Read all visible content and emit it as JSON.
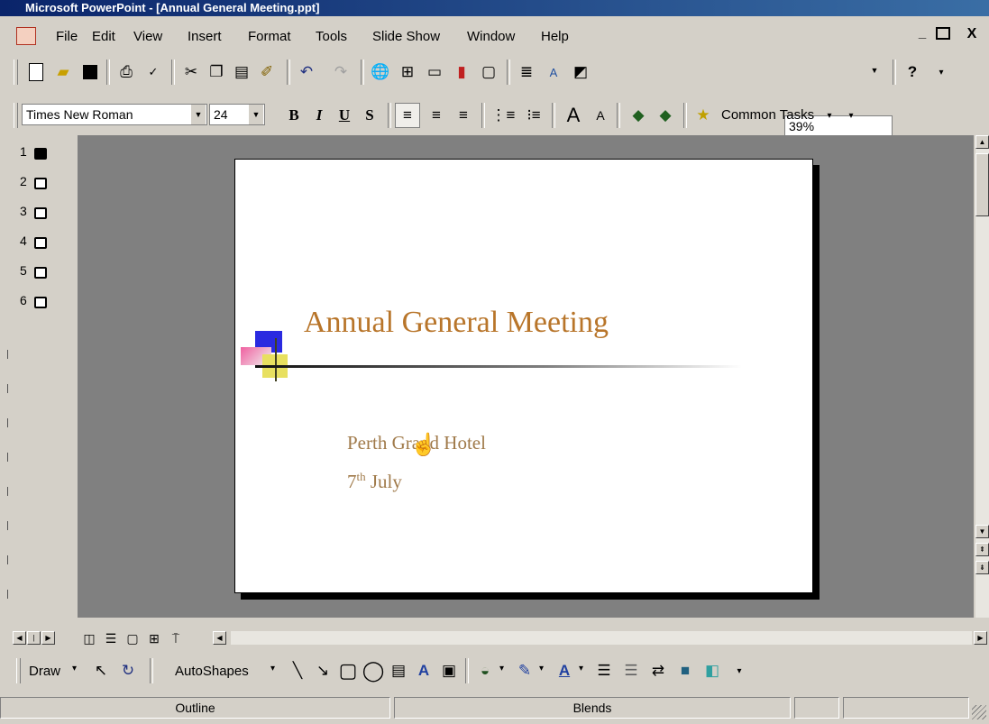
{
  "window": {
    "title": "Microsoft PowerPoint - [Annual General Meeting.ppt]"
  },
  "menu": {
    "items": [
      "File",
      "Edit",
      "View",
      "Insert",
      "Format",
      "Tools",
      "Slide Show",
      "Window",
      "Help"
    ],
    "window_controls": [
      "_",
      "Ԃ",
      "X"
    ]
  },
  "standard_toolbar": {
    "zoom": "39%"
  },
  "formatting_toolbar": {
    "font_name": "Times New Roman",
    "font_size": "24",
    "bold": "B",
    "italic": "I",
    "underline": "U",
    "shadow": "S",
    "common_tasks": "Common Tasks"
  },
  "outline": {
    "slide_numbers": [
      "1",
      "2",
      "3",
      "4",
      "5",
      "6"
    ]
  },
  "slide": {
    "title": "Annual General Meeting",
    "line1": "Perth Grand Hotel",
    "line2_main": "7",
    "line2_sup": "th",
    "line2_rest": " July",
    "title_color": "#b8752a",
    "body_color": "#a07a4a"
  },
  "drawing_toolbar": {
    "draw": "Draw",
    "autoshapes": "AutoShapes"
  },
  "status": {
    "left": "Outline",
    "center": "Blends"
  }
}
